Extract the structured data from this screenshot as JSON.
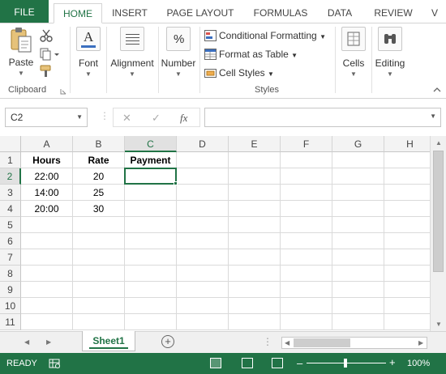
{
  "ribbon_tabs": [
    "FILE",
    "HOME",
    "INSERT",
    "PAGE LAYOUT",
    "FORMULAS",
    "DATA",
    "REVIEW",
    "V"
  ],
  "clipboard": {
    "paste_label": "Paste",
    "group_label": "Clipboard"
  },
  "font_group": {
    "label": "Font"
  },
  "alignment_group": {
    "label": "Alignment"
  },
  "number_group": {
    "label": "Number",
    "icon_glyph": "%"
  },
  "styles": {
    "conditional_formatting": "Conditional Formatting",
    "format_as_table": "Format as Table",
    "cell_styles": "Cell Styles",
    "group_label": "Styles"
  },
  "cells_group": {
    "label": "Cells"
  },
  "editing_group": {
    "label": "Editing"
  },
  "formula_bar": {
    "name_box": "C2",
    "fx_symbol": "fx",
    "formula": ""
  },
  "columns": [
    "A",
    "B",
    "C",
    "D",
    "E",
    "F",
    "G",
    "H"
  ],
  "selected_column": "C",
  "rows": [
    "1",
    "2",
    "3",
    "4",
    "5",
    "6",
    "7",
    "8",
    "9",
    "10",
    "11"
  ],
  "selected_row": "2",
  "table": {
    "header": [
      "Hours",
      "Rate",
      "Payment"
    ],
    "data": [
      [
        "22:00",
        "20",
        ""
      ],
      [
        "14:00",
        "25",
        ""
      ],
      [
        "20:00",
        "30",
        ""
      ]
    ]
  },
  "sheet_tab": "Sheet1",
  "status": {
    "ready": "READY",
    "zoom": "100%"
  },
  "colors": {
    "accent": "#217346",
    "selection": "#217346"
  },
  "icons": [
    "paste-icon",
    "cut-icon",
    "copy-icon",
    "format-painter-icon",
    "font-icon",
    "alignment-icon",
    "number-icon",
    "conditional-formatting-icon",
    "format-table-icon",
    "cell-styles-icon",
    "cells-icon",
    "editing-icon"
  ]
}
